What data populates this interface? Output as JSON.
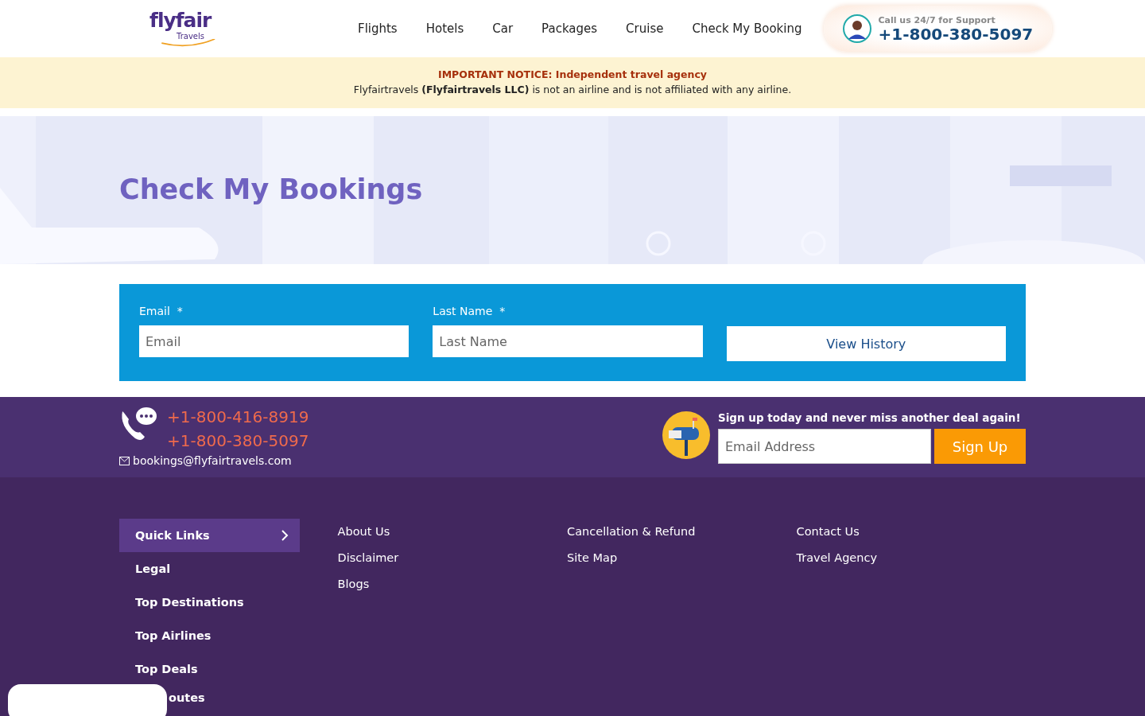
{
  "header": {
    "logo": {
      "name": "flyfair",
      "sub": "Travels"
    },
    "nav": [
      {
        "label": "Flights"
      },
      {
        "label": "Hotels"
      },
      {
        "label": "Car"
      },
      {
        "label": "Packages"
      },
      {
        "label": "Cruise"
      },
      {
        "label": "Check My Booking"
      }
    ],
    "support": {
      "caption": "Call us 24/7 for Support",
      "phone": "+1-800-380-5097"
    }
  },
  "notice": {
    "title": "IMPORTANT NOTICE: Independent travel agency",
    "text": "Flyfairtravels **(Flyfairtravels LLC)** is not an airline and is not affiliated with any airline."
  },
  "hero": {
    "title": "Check My Bookings"
  },
  "form": {
    "fields": [
      {
        "label": "Email",
        "required_mark": "*",
        "placeholder": "Email"
      },
      {
        "label": "Last Name",
        "required_mark": "*",
        "placeholder": "Last Name"
      }
    ],
    "button": "View History"
  },
  "contact": {
    "phones": [
      "+1-800-416-8919",
      "+1-800-380-5097"
    ],
    "email": "bookings@flyfairtravels.com"
  },
  "newsletter": {
    "headline": "Sign up today and never miss another deal again!",
    "placeholder": "Email Address",
    "button": "Sign Up"
  },
  "footer": {
    "menu": [
      {
        "label": "Quick Links",
        "selected": true
      },
      {
        "label": "Legal",
        "selected": false
      },
      {
        "label": "Top Destinations",
        "selected": false
      },
      {
        "label": "Top Airlines",
        "selected": false
      },
      {
        "label": "Top Deals",
        "selected": false
      }
    ],
    "menu_cut_item": "outes",
    "columns": [
      [
        "About Us",
        "Disclaimer",
        "Blogs"
      ],
      [
        "Cancellation & Refund",
        "Site Map"
      ],
      [
        "Contact Us",
        "Travel Agency"
      ]
    ]
  }
}
